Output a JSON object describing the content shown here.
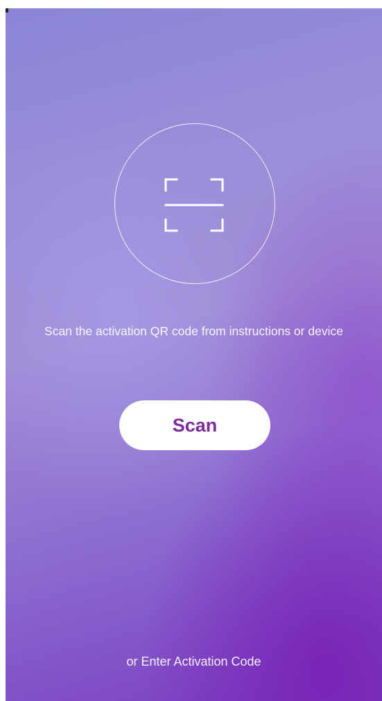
{
  "scan_area": {
    "icon": "qr-scan-icon"
  },
  "instructions": {
    "text": "Scan the activation QR code from instructions or device"
  },
  "scan_button": {
    "label": "Scan"
  },
  "enter_code_link": {
    "label": "or Enter Activation Code"
  },
  "colors": {
    "background_top": "#8a84d8",
    "background_bottom": "#7a3cc0",
    "button_background": "#ffffff",
    "button_text": "#7a2c9c",
    "text": "#ffffff"
  }
}
